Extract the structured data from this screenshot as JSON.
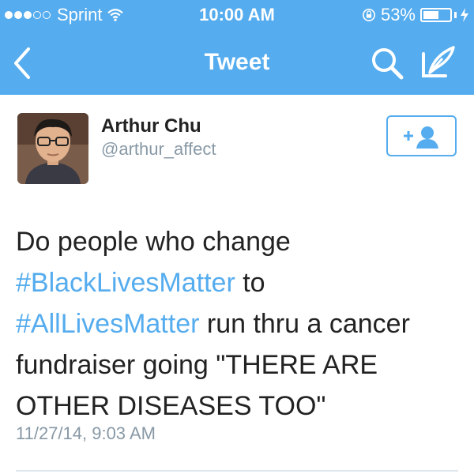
{
  "status_bar": {
    "carrier": "Sprint",
    "time": "10:00 AM",
    "battery_percent": "53%",
    "battery_level": 0.53,
    "signal_strength": 3,
    "icons": [
      "signal-dots-icon",
      "wifi-icon",
      "rotation-lock-icon",
      "battery-icon",
      "charging-bolt-icon"
    ]
  },
  "nav": {
    "title": "Tweet",
    "icons": [
      "back-chevron-icon",
      "search-icon",
      "compose-icon"
    ]
  },
  "tweet": {
    "author_name": "Arthur Chu",
    "author_handle": "@arthur_affect",
    "follow_icon": "follow-user-icon",
    "lines": [
      {
        "text_before": "Do people who change",
        "hashtag": "",
        "text_after": ""
      },
      {
        "text_before": "",
        "hashtag": "#BlackLivesMatter",
        "text_after": " to"
      },
      {
        "text_before": "",
        "hashtag": "#AllLivesMatter",
        "text_after": " run thru a cancer"
      },
      {
        "text_before": "fundraiser going \"THERE ARE",
        "hashtag": "",
        "text_after": ""
      },
      {
        "text_before": "OTHER DISEASES TOO\"",
        "hashtag": "",
        "text_after": ""
      }
    ],
    "timestamp": "11/27/14, 9:03 AM"
  },
  "colors": {
    "brand_blue": "#55acee",
    "text": "#222222",
    "muted": "#8899a6"
  }
}
